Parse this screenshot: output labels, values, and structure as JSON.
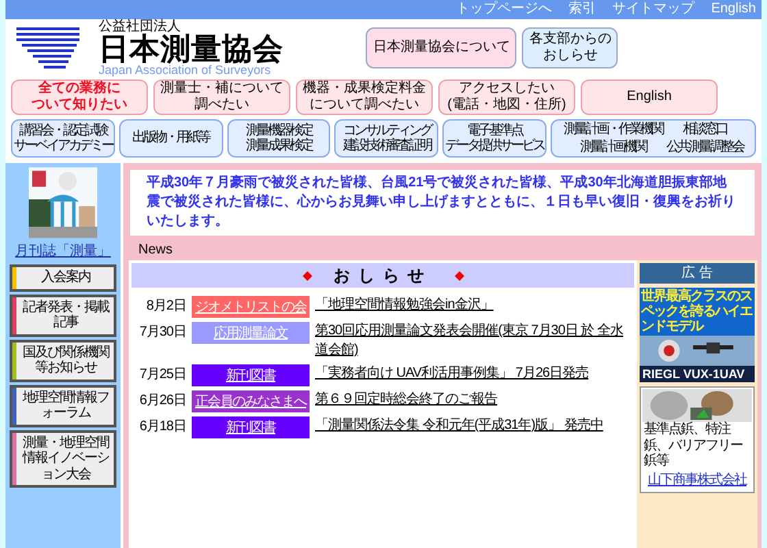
{
  "top_links": [
    "トップページへ",
    "索引",
    "サイトマップ",
    "English"
  ],
  "org": {
    "type": "公益社団法人",
    "name": "日本測量協会",
    "english": "Japan Association of Surveyors"
  },
  "header_buttons": [
    {
      "lines": [
        "日本測量協会について"
      ],
      "color": "#ffdde6"
    },
    {
      "lines": [
        "各支部からの",
        "おしらせ"
      ],
      "color": "#ddeeff"
    }
  ],
  "nav_primary": [
    {
      "lines": [
        "全ての業務に",
        "ついて知りたい"
      ],
      "emphasized": true
    },
    {
      "lines": [
        "測量士・補について",
        "調べたい"
      ],
      "emphasized": false
    },
    {
      "lines": [
        "機器・成果検定料金",
        "について調べたい"
      ],
      "emphasized": false
    },
    {
      "lines": [
        "アクセスしたい",
        "(電話・地図・住所)"
      ],
      "emphasized": false
    },
    {
      "lines": [
        "English"
      ],
      "emphasized": false
    }
  ],
  "nav_secondary": [
    {
      "lines": [
        "講習会・認定試験",
        "サーベイアカデミー"
      ]
    },
    {
      "lines": [
        "出版物・用紙等"
      ]
    },
    {
      "lines": [
        "測量機器検定",
        "測量成果検定"
      ]
    },
    {
      "lines": [
        "コンサルティング",
        "建設技術審査証明"
      ]
    },
    {
      "lines": [
        "電子基準点",
        "データ提供サービス"
      ]
    },
    {
      "lines": [
        "測量計画・作業機関",
        "測量計画機関",
        "相談窓口",
        "公共測量調整会"
      ],
      "kind": "split"
    }
  ],
  "magazine_link": "月刊誌「測量」",
  "sidebar": [
    {
      "label": "入会案内",
      "color": "#f5c400"
    },
    {
      "label": "記者発表・掲載記事",
      "color": "#e04060"
    },
    {
      "label": "国及び関係機関等お知らせ",
      "color": "#a0c020"
    },
    {
      "label": "地理空間情報フォーラム",
      "color": "#4060c0"
    },
    {
      "label": "測量・地理空間情報イノベーション大会",
      "color": "#e070a0"
    }
  ],
  "message": "平成30年７月豪雨で被災された皆様、台風21号で被災された皆様、平成30年北海道胆振東部地震で被災された皆様に、心からお見舞い申し上げますとともに、１日も早い復旧・復興をお祈りいたします。",
  "news_label": "News",
  "notices_title": "おしらせ",
  "notices": [
    {
      "date": "8月2日",
      "tag": "ジオメトリストの会",
      "color": "#ff6666",
      "title": "「地理空間情報勉強会in金沢」"
    },
    {
      "date": "7月30日",
      "tag": "応用測量論文",
      "color": "#9999ff",
      "title": "第30回応用測量論文発表会開催(東京 7月30日 於 全水道会館)"
    },
    {
      "date": "7月25日",
      "tag": "新刊図書",
      "color": "#6600ff",
      "title": "「実務者向け UAV利活用事例集」 7月26日発売"
    },
    {
      "date": "6月26日",
      "tag": "正会員のみなさまへ",
      "color": "#9933cc",
      "title": "第６９回定時総会終了のご報告"
    },
    {
      "date": "6月18日",
      "tag": "新刊図書",
      "color": "#6600ff",
      "title": "「測量関係法令集 令和元年(平成31年)版」 発売中"
    }
  ],
  "ads": {
    "title": "広 告",
    "banner_text": "世界最高クラスのスペックを誇るハイエンドモデル",
    "banner_model": "RIEGL VUX-1UAV",
    "second_text": "基準点鋲、特注鋲、バリアフリー鋲等",
    "second_company": "山下商事株式会社"
  }
}
